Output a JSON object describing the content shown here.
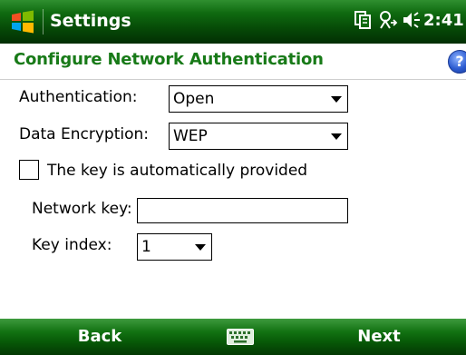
{
  "titlebar": {
    "title": "Settings",
    "time": "2:41",
    "icons": [
      "windows-start-icon",
      "data-connection-icon",
      "signal-icon",
      "volume-icon"
    ]
  },
  "header": {
    "title": "Configure Network Authentication",
    "help_label": "?"
  },
  "form": {
    "authentication_label": "Authentication:",
    "authentication_value": "Open",
    "encryption_label": "Data Encryption:",
    "encryption_value": "WEP",
    "auto_key_label": "The key is automatically provided",
    "auto_key_checked": false,
    "network_key_label": "Network key:",
    "network_key_value": "",
    "key_index_label": "Key index:",
    "key_index_value": "1"
  },
  "softkeys": {
    "left": "Back",
    "right": "Next",
    "center_icon": "keyboard-icon"
  },
  "colors": {
    "title_green": "#187a18",
    "bar_green": "#0f6a10"
  }
}
